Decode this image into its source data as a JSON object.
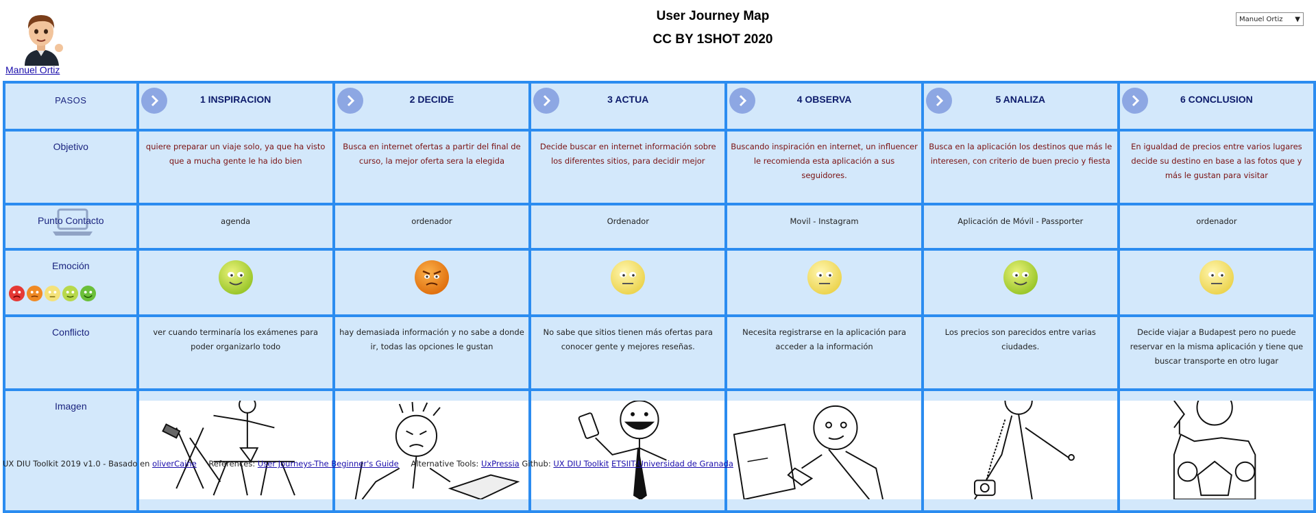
{
  "user": {
    "name": "Manuel Ortiz",
    "selected": "Manuel Ortiz"
  },
  "header": {
    "title": "User Journey Map",
    "subtitle": "CC BY 1SHOT 2020"
  },
  "rows": {
    "pasos": "PASOS",
    "objetivo": "Objetivo",
    "contacto": "Punto Contacto",
    "emocion": "Emoción",
    "conflicto": "Conflicto",
    "imagen": "Imagen"
  },
  "steps": [
    {
      "title": "1 INSPIRACION",
      "objetivo": "quiere preparar un viaje solo, ya que ha visto que a mucha gente le ha ido bien",
      "contacto": "agenda",
      "emotion": "happy",
      "conflicto": "ver cuando terminaría los exámenes para poder organizarlo todo",
      "image": "person-planning-drawing"
    },
    {
      "title": "2 DECIDE",
      "objetivo": "Busca en internet ofertas a partir del final de curso, la mejor oferta sera la elegida",
      "contacto": "ordenador",
      "emotion": "angry",
      "conflicto": "hay demasiada información y no sabe a donde ir, todas las opciones le gustan",
      "image": "frustrated-person-at-laptop"
    },
    {
      "title": "3 ACTUA",
      "objetivo": "Decide buscar en internet información sobre los diferentes sitios, para decidir mejor",
      "contacto": "Ordenador",
      "emotion": "neutral",
      "conflicto": "No sabe que sitios tienen más ofertas para conocer gente y mejores reseñas.",
      "image": "person-with-phone"
    },
    {
      "title": "4 OBSERVA",
      "objetivo": "Buscando inspiración en internet, un influencer le recomienda esta aplicación a sus seguidores.",
      "contacto": "Movil - Instagram",
      "emotion": "neutral",
      "conflicto": "Necesita registrarse en la aplicación para acceder a la información",
      "image": "person-at-computer"
    },
    {
      "title": "5 ANALIZA",
      "objetivo": "Busca en la aplicación los destinos que más le interesen, con criterio de buen precio y fiesta",
      "contacto": "Aplicación de Móvil - Passporter",
      "emotion": "happy",
      "conflicto": "Los precios son parecidos entre varias ciudades.",
      "image": "person-on-telephone"
    },
    {
      "title": "6 CONCLUSION",
      "objetivo": "En igualdad de precios entre varios lugares decide su destino en base a las fotos que y más le gustan para visitar",
      "contacto": "ordenador",
      "emotion": "neutral",
      "conflicto": "Decide viajar a Budapest pero no puede reservar en la misma aplicación y tiene que buscar transporte en otro lugar",
      "image": "person-relaxing-drink"
    }
  ],
  "footer": {
    "prefix": "UX DIU Toolkit 2019 v1.0 - Basado en",
    "link1": "oliverCaine",
    "refs": "References:",
    "link2": "User Journeys-The Beginner's Guide",
    "alt": "Alternative Tools:",
    "link3": "UxPressia",
    "gh": "Github:",
    "link4": "UX DIU Toolkit",
    "link5": "ETSIIT-Universidad de Granada"
  },
  "colors": {
    "grid": "#2b8cf0",
    "cell": "#d3e8fb",
    "stepTitle": "#0d1b6b",
    "objetivoText": "#7a1010"
  }
}
